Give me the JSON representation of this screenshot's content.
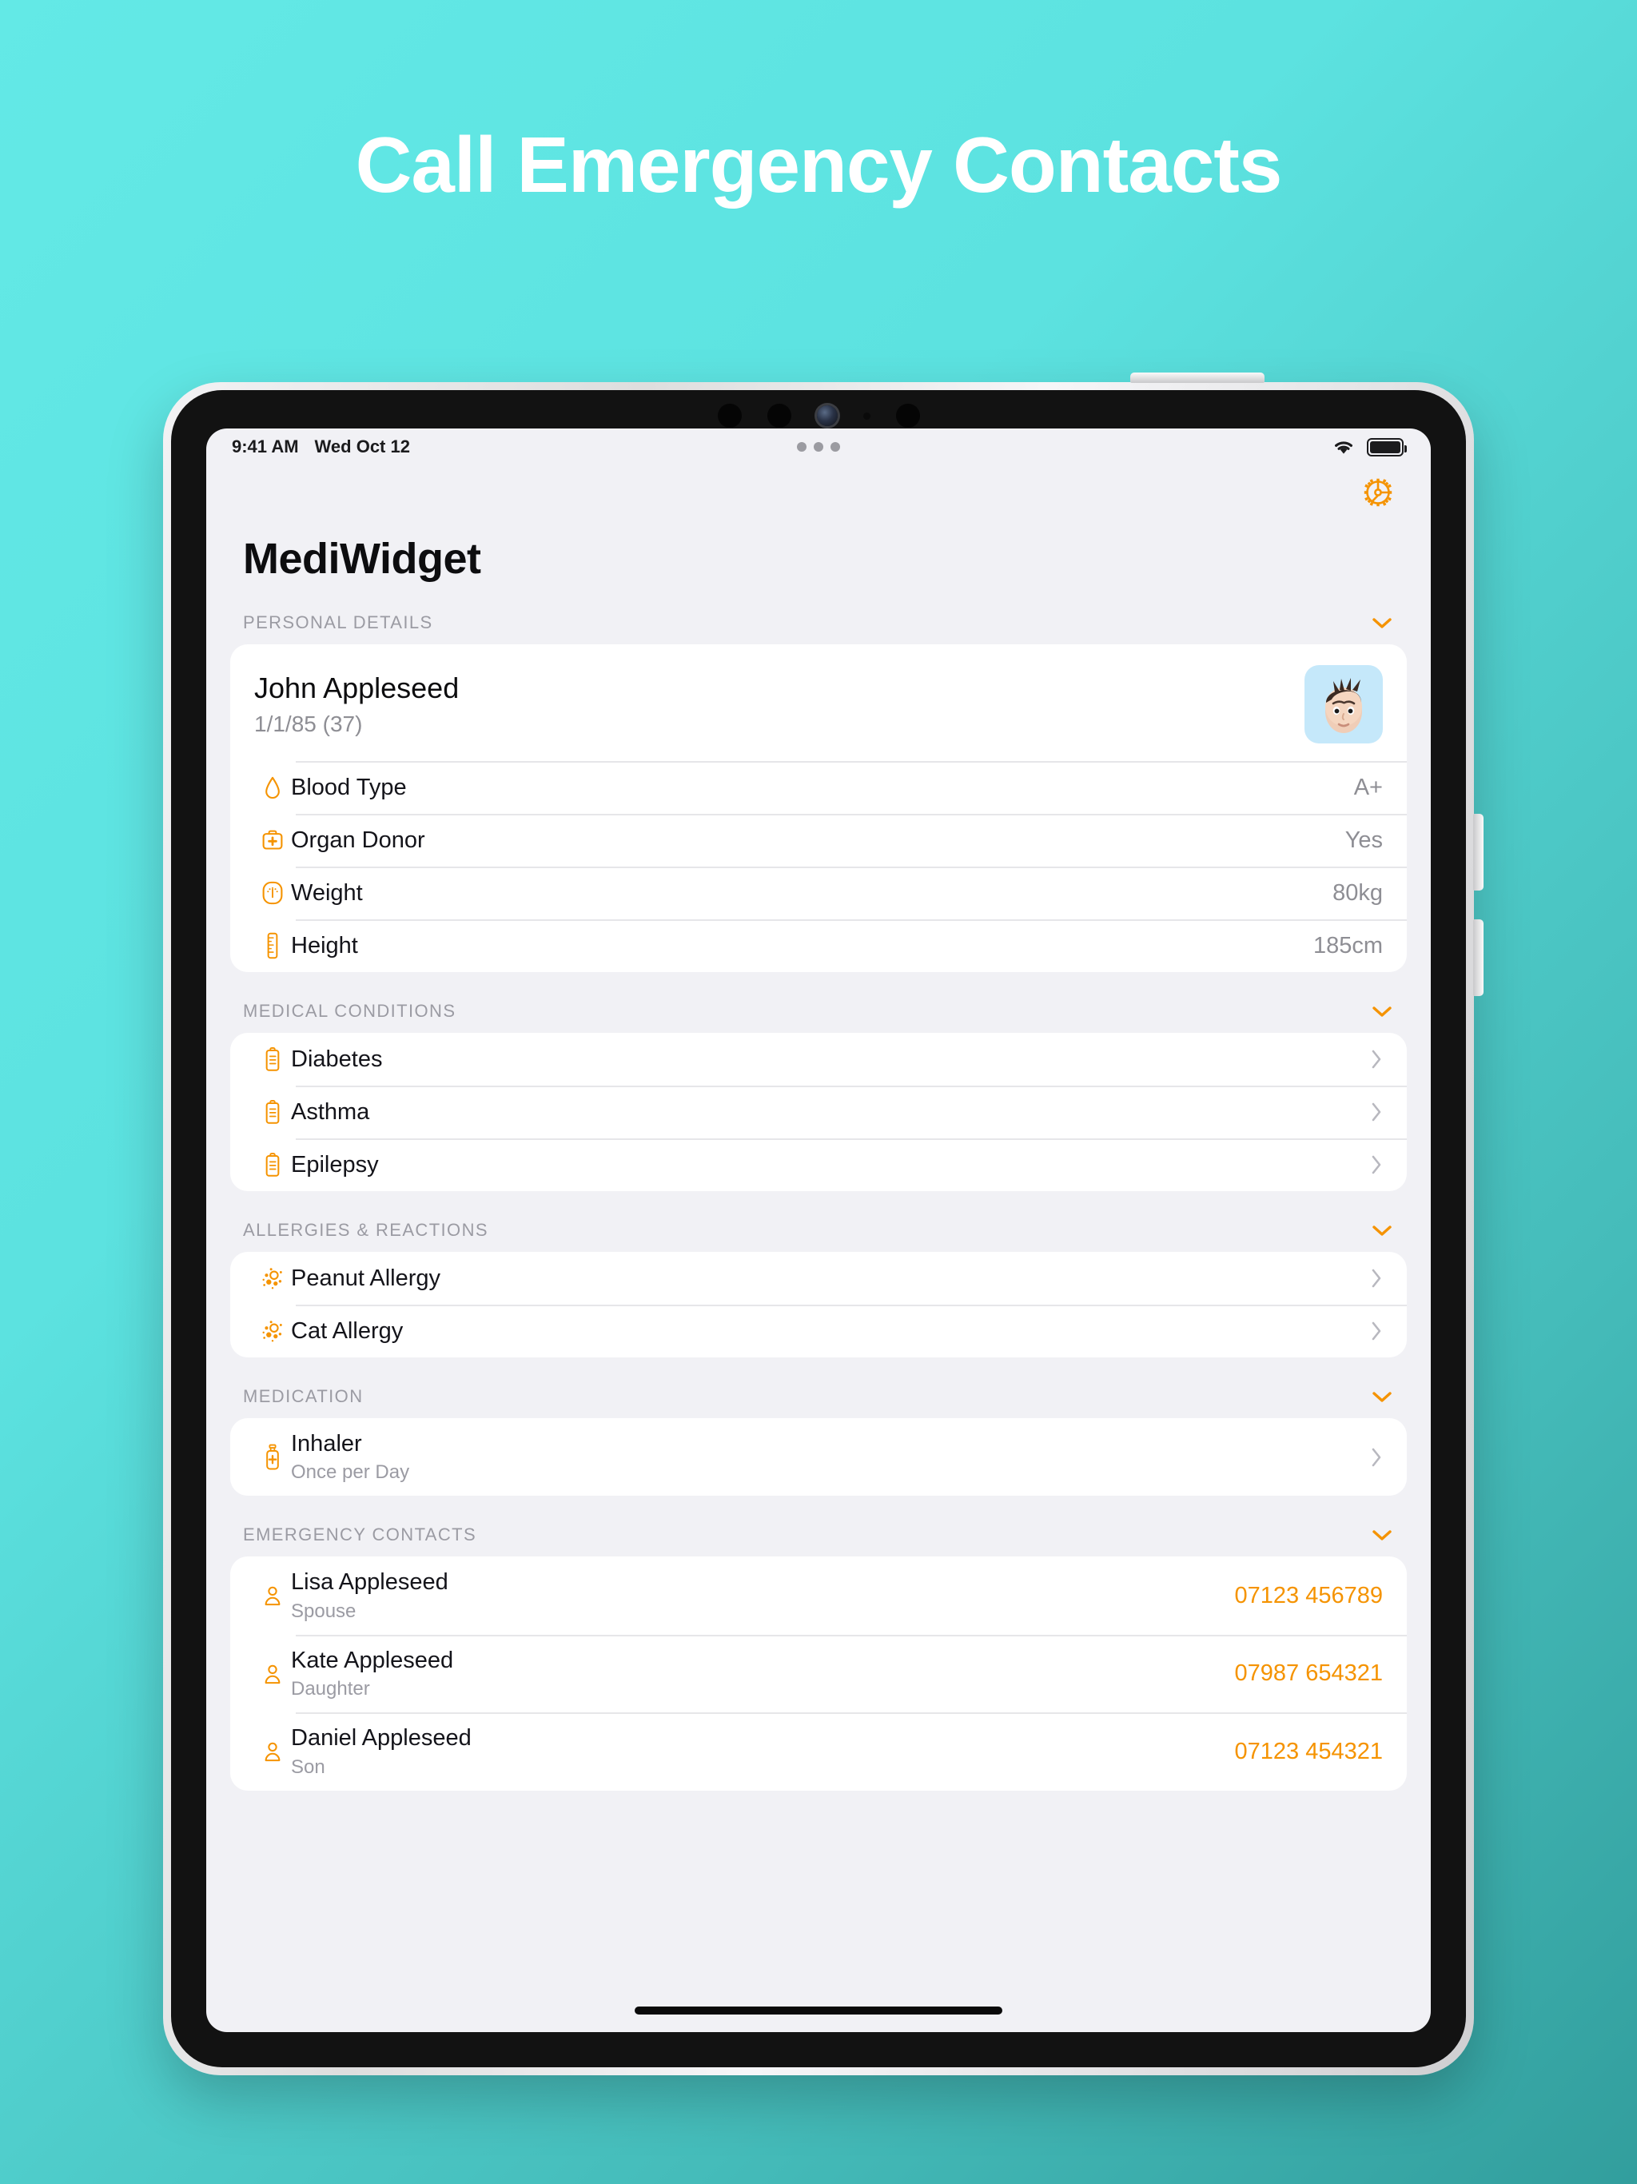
{
  "promo": {
    "headline": "Call Emergency Contacts"
  },
  "statusbar": {
    "time": "9:41 AM",
    "date": "Wed Oct 12",
    "multitask_dots": "•••",
    "wifi_icon": "wifi-icon",
    "battery_icon": "battery-full-icon"
  },
  "app": {
    "title": "MediWidget",
    "settings_icon": "gear-icon"
  },
  "sections": {
    "personal": {
      "header": "PERSONAL DETAILS",
      "collapse_icon": "chevron-down-icon",
      "person": {
        "name": "John Appleseed",
        "dob": "1/1/85 (37)",
        "avatar_icon": "memoji-avatar"
      },
      "rows": [
        {
          "icon": "blood-drop-icon",
          "label": "Blood Type",
          "value": "A+"
        },
        {
          "icon": "first-aid-kit-icon",
          "label": "Organ Donor",
          "value": "Yes"
        },
        {
          "icon": "scale-gauge-icon",
          "label": "Weight",
          "value": "80kg"
        },
        {
          "icon": "ruler-icon",
          "label": "Height",
          "value": "185cm"
        }
      ]
    },
    "conditions": {
      "header": "MEDICAL CONDITIONS",
      "collapse_icon": "chevron-down-icon",
      "rows": [
        {
          "icon": "clipboard-icon",
          "label": "Diabetes",
          "chevron": "chevron-right-icon"
        },
        {
          "icon": "clipboard-icon",
          "label": "Asthma",
          "chevron": "chevron-right-icon"
        },
        {
          "icon": "clipboard-icon",
          "label": "Epilepsy",
          "chevron": "chevron-right-icon"
        }
      ]
    },
    "allergies": {
      "header": "ALLERGIES & REACTIONS",
      "collapse_icon": "chevron-down-icon",
      "rows": [
        {
          "icon": "allergen-burst-icon",
          "label": "Peanut Allergy",
          "chevron": "chevron-right-icon"
        },
        {
          "icon": "allergen-burst-icon",
          "label": "Cat Allergy",
          "chevron": "chevron-right-icon"
        }
      ]
    },
    "medication": {
      "header": "MEDICATION",
      "collapse_icon": "chevron-down-icon",
      "rows": [
        {
          "icon": "inhaler-icon",
          "title": "Inhaler",
          "subtitle": "Once per Day",
          "chevron": "chevron-right-icon"
        }
      ]
    },
    "contacts": {
      "header": "EMERGENCY CONTACTS",
      "collapse_icon": "chevron-down-icon",
      "rows": [
        {
          "icon": "person-icon",
          "name": "Lisa Appleseed",
          "relation": "Spouse",
          "phone": "07123 456789"
        },
        {
          "icon": "person-icon",
          "name": "Kate Appleseed",
          "relation": "Daughter",
          "phone": "07987 654321"
        },
        {
          "icon": "person-icon",
          "name": "Daniel Appleseed",
          "relation": "Son",
          "phone": "07123 454321"
        }
      ]
    }
  },
  "colors": {
    "accent": "#f59300",
    "background_start": "#63e9e6",
    "background_end": "#329e9d",
    "card": "#ffffff",
    "screen": "#f1f1f5"
  }
}
